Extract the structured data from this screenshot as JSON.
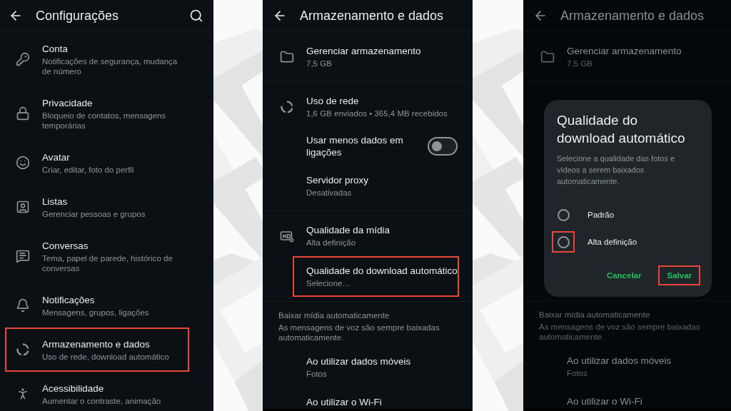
{
  "screens": [
    {
      "title": "Configurações",
      "search": true,
      "dimmed": false,
      "groups": [
        {
          "rows": [
            {
              "kind": "item",
              "title": "Conta",
              "subtitle": "Notificações de segurança, mudança de número",
              "highlighted": false
            },
            {
              "kind": "item",
              "title": "Privacidade",
              "subtitle": "Bloqueio de contatos, mensagens temporárias",
              "highlighted": false
            },
            {
              "kind": "item",
              "title": "Avatar",
              "subtitle": "Criar, editar, foto do perfil",
              "highlighted": false
            },
            {
              "kind": "item",
              "title": "Listas",
              "subtitle": "Gerenciar pessoas e grupos",
              "highlighted": false
            },
            {
              "kind": "item",
              "title": "Conversas",
              "subtitle": "Tema, papel de parede, histórico de conversas",
              "highlighted": false
            },
            {
              "kind": "item",
              "title": "Notificações",
              "subtitle": "Mensagens, grupos, ligações",
              "highlighted": false
            },
            {
              "kind": "item",
              "title": "Armazenamento e dados",
              "subtitle": "Uso de rede, download automático",
              "highlighted": true
            },
            {
              "kind": "item",
              "title": "Acessibilidade",
              "subtitle": "Aumentar o contraste, animação",
              "highlighted": false
            }
          ]
        }
      ]
    },
    {
      "title": "Armazenamento e dados",
      "search": false,
      "dimmed": false,
      "groups": [
        {
          "rows": [
            {
              "kind": "item",
              "title": "Gerenciar armazenamento",
              "subtitle": "7,5 GB",
              "highlighted": false
            }
          ]
        },
        {
          "rows": [
            {
              "kind": "item",
              "title": "Uso de rede",
              "subtitle": "1,6 GB enviados • 365,4 MB recebidos",
              "highlighted": false
            },
            {
              "kind": "toggle",
              "title": "Usar menos dados em ligações",
              "on": false
            },
            {
              "kind": "item",
              "title": "Servidor proxy",
              "subtitle": "Desativadas",
              "highlighted": false
            }
          ]
        },
        {
          "rows": [
            {
              "kind": "item",
              "title": "Qualidade da mídia",
              "subtitle": "Alta definição",
              "highlighted": false
            },
            {
              "kind": "item",
              "title": "Qualidade do download automático",
              "subtitle": "Selecione…",
              "highlighted": true
            }
          ]
        },
        {
          "rows": [
            {
              "kind": "section",
              "title": "Baixar mídia automaticamente",
              "subtitle": "As mensagens de voz são sempre baixadas automaticamente."
            },
            {
              "kind": "item",
              "title": "Ao utilizar dados móveis",
              "subtitle": "Fotos",
              "highlighted": false
            },
            {
              "kind": "item",
              "title": "Ao utilizar o Wi-Fi",
              "highlighted": false
            }
          ]
        }
      ]
    },
    {
      "title": "Armazenamento e dados",
      "search": false,
      "dimmed": true,
      "groups": [
        {
          "rows": [
            {
              "kind": "item",
              "title": "Gerenciar armazenamento",
              "subtitle": "7,5 GB",
              "highlighted": false
            }
          ]
        },
        {
          "rows": [
            {
              "kind": "section",
              "title": "Baixar mídia automaticamente",
              "subtitle": "As mensagens de voz são sempre baixadas automaticamente."
            },
            {
              "kind": "item",
              "title": "Ao utilizar dados móveis",
              "subtitle": "Fotos",
              "highlighted": false
            },
            {
              "kind": "item",
              "title": "Ao utilizar o Wi-Fi",
              "highlighted": false
            }
          ]
        }
      ],
      "dialog": {
        "title": "Qualidade do download automático",
        "text": "Selecione a qualidade das fotos e vídeos a serem baixados automaticamente.",
        "options": [
          {
            "label": "Padrão",
            "selected": false,
            "highlighted": false
          },
          {
            "label": "Alta definição",
            "selected": false,
            "highlighted": true
          }
        ],
        "buttons": [
          {
            "label": "Cancelar",
            "highlighted": false
          },
          {
            "label": "Salvar",
            "highlighted": true
          }
        ]
      }
    }
  ]
}
